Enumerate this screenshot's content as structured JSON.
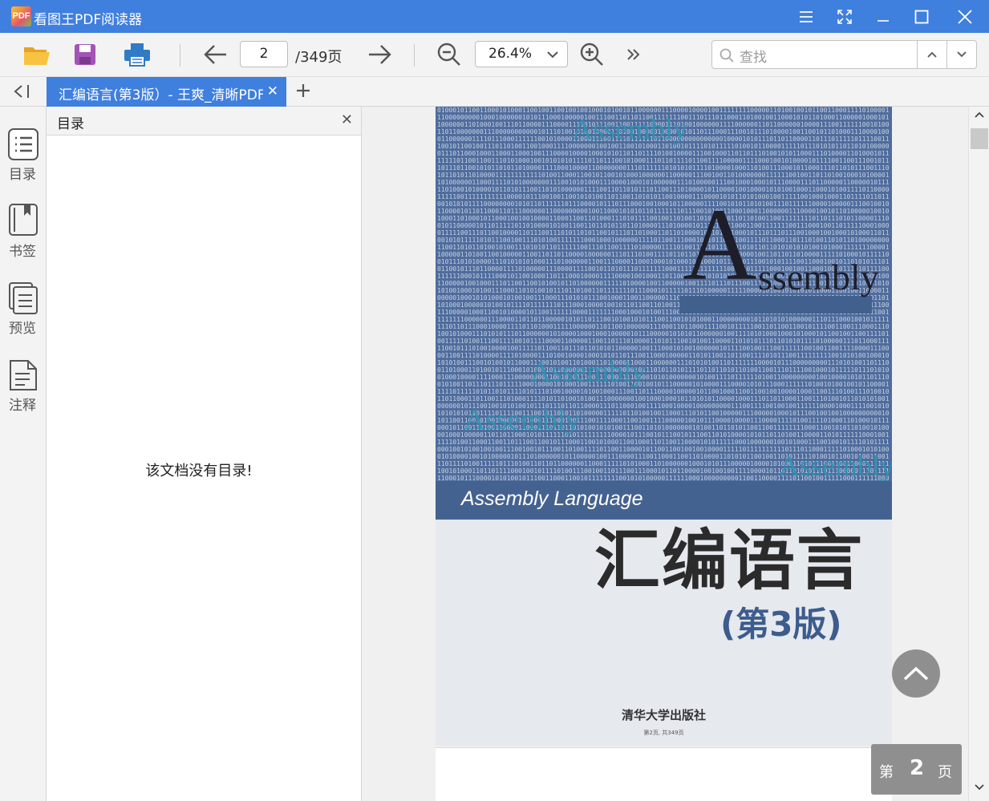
{
  "app": {
    "logo_text": "PDF",
    "title": "看图王PDF阅读器"
  },
  "toolbar": {
    "current_page": "2",
    "total_pages": "/349页",
    "zoom": "26.4%",
    "search_placeholder": "查找"
  },
  "tabs": [
    {
      "label": "汇编语言(第3版）- 王爽_清晰PDF"
    }
  ],
  "sidebar": {
    "items": [
      {
        "label": "目录",
        "icon": "list-icon"
      },
      {
        "label": "书签",
        "icon": "bookmark-icon"
      },
      {
        "label": "预览",
        "icon": "pages-icon"
      },
      {
        "label": "注释",
        "icon": "annotation-icon"
      }
    ]
  },
  "panel": {
    "title": "目录",
    "empty_message": "该文档没有目录!"
  },
  "document": {
    "cover_big_letter": "A",
    "cover_big_rest": "ssembly",
    "watermark_word": "Assembly",
    "band_text": "Assembly Language",
    "zh_title": "汇编语言",
    "zh_edition": "(第3版)",
    "publisher": "清华大学出版社",
    "page_footer": "第2页, 共349页"
  },
  "page_badge": {
    "prefix": "第",
    "number": "2",
    "suffix": "页"
  },
  "colors": {
    "accent": "#3f7fde",
    "cover_blue": "#4f6c9c",
    "watermark": "#2d93b4"
  }
}
